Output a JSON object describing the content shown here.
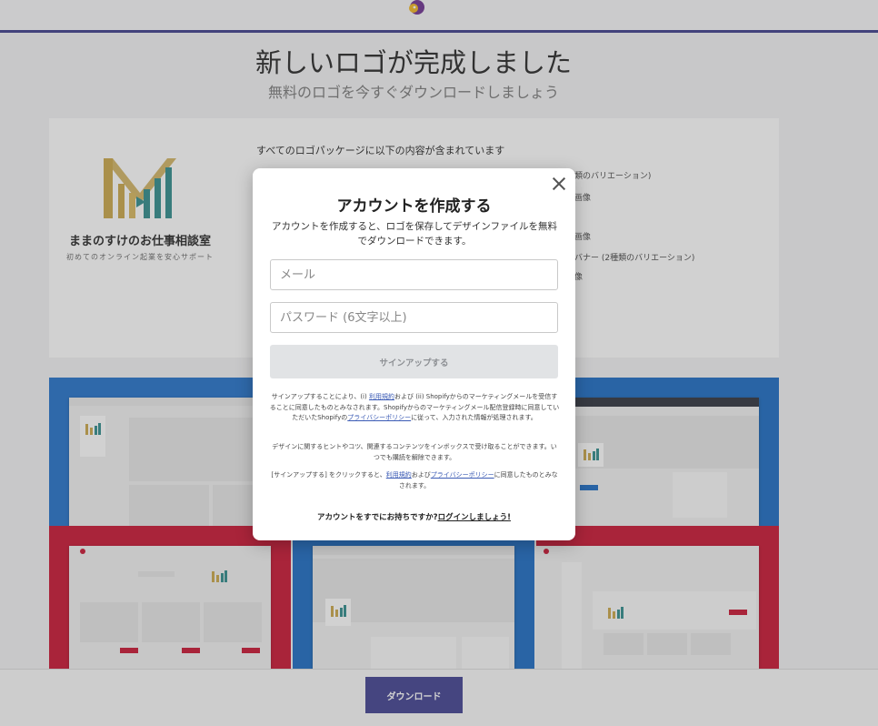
{
  "page": {
    "title": "新しいロゴが完成しました",
    "subtitle": "無料のロゴを今すぐダウンロードしましょう"
  },
  "brand": {
    "name": "ままのすけのお仕事相談室",
    "tagline": "初めてのオンライン起業を安心サポート"
  },
  "package": {
    "heading": "すべてのロゴパッケージに以下の内容が含まれています",
    "visible_items": [
      "類のバリエーション)",
      "画像",
      "画像",
      "バナー (2種類のバリエーション)",
      "像"
    ]
  },
  "footer": {
    "download_label": "ダウンロード"
  },
  "modal": {
    "title": "アカウントを作成する",
    "description": "アカウントを作成すると、ロゴを保存してデザインファイルを無料でダウンロードできます。",
    "email_placeholder": "メール",
    "password_placeholder": "パスワード (6文字以上)",
    "signup_label": "サインアップする",
    "legal1_a": "サインアップすることにより、(i) ",
    "legal1_link1": "利用規約",
    "legal1_b": "および (ii) Shopifyからのマーケティングメールを受信することに同意したものとみなされます。Shopifyからのマーケティングメール配信登録時に同意していただいたShopifyの",
    "legal1_link2": "プライバシーポリシー",
    "legal1_c": "に従って、入力された情報が処理されます。",
    "legal2": "デザインに関するヒントやコツ、関連するコンテンツをインボックスで受け取ることができます。いつでも購読を解除できます。",
    "legal3_a": "[サインアップする] をクリックすると、",
    "legal3_link1": "利用規約",
    "legal3_b": "および",
    "legal3_link2": "プライバシーポリシー",
    "legal3_c": "に同意したものとみなされます。",
    "login_prompt": "アカウントをすでにお持ちですか?",
    "login_link": "ログインしましょう!"
  },
  "colors": {
    "accent": "#3d3d8f",
    "mock_blue": "#1769c2",
    "mock_red": "#c8102e",
    "logo_gold": "#c9a646",
    "logo_teal": "#2c8a8a"
  }
}
